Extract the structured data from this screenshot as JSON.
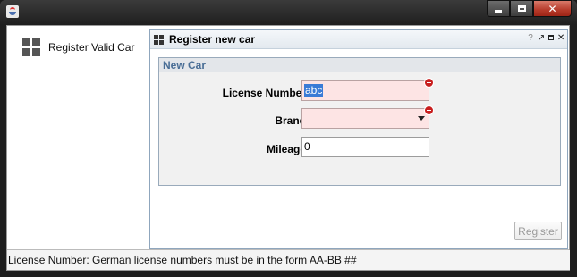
{
  "window": {
    "title": ""
  },
  "nav": {
    "items": [
      {
        "label": "Register Valid Car",
        "icon": "grid-icon"
      }
    ]
  },
  "frame": {
    "title": "Register new car",
    "buttons": {
      "help": "?",
      "close": "✕"
    }
  },
  "form": {
    "group_title": "New Car",
    "license": {
      "label": "License Number",
      "value": "abc",
      "state": "error"
    },
    "brand": {
      "label": "Brand",
      "value": "",
      "state": "error"
    },
    "mileage": {
      "label": "Mileage",
      "value": "0"
    },
    "register_label": "Register"
  },
  "status": {
    "text": "License Number: German license numbers must be in the form AA-BB ##"
  },
  "colors": {
    "error_bg": "#fde4e4",
    "error_icon": "#c81e1e",
    "group_title": "#4a6e96",
    "selection": "#3a7bd6"
  }
}
